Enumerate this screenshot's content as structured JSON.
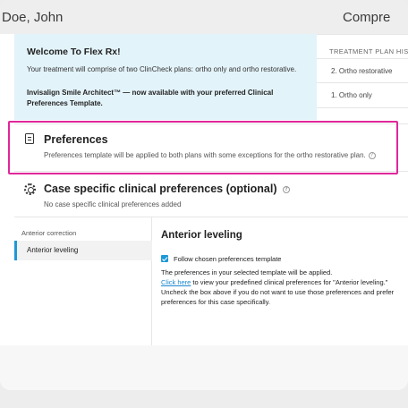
{
  "header": {
    "patient_name": "Doe, John",
    "right_title": "Compre"
  },
  "welcome": {
    "title": "Welcome To Flex Rx!",
    "text": "Your treatment will comprise of two ClinCheck plans: ortho only and ortho restorative.",
    "note": "Invisalign Smile Architect™ — now available with your preferred Clinical Preferences Template."
  },
  "history": {
    "title": "TREATMENT PLAN HISTO",
    "items": [
      "2. Ortho restorative",
      "1. Ortho only"
    ]
  },
  "preferences": {
    "title": "Preferences",
    "description": "Preferences template will be applied to both plans with some exceptions for the ortho restorative plan.",
    "help_glyph": "?"
  },
  "case_specific": {
    "title": "Case specific clinical preferences (optional)",
    "help_glyph": "?",
    "subtitle": "No case specific clinical preferences added"
  },
  "nav": {
    "heading": "Anterior correction",
    "items": [
      "Anterior leveling"
    ]
  },
  "content": {
    "title": "Anterior leveling",
    "checkbox_label": "Follow chosen preferences template",
    "checkbox_checked": true,
    "line1": "The preferences in your selected template will be applied.",
    "link_text": "Click here",
    "line2_rest": " to view your predefined clinical preferences for \"Anterior leveling.\"",
    "line3": "Uncheck the box above if you do not want to use those preferences and prefer",
    "line4": "preferences for this case specifically."
  },
  "colors": {
    "accent": "#1e98d7",
    "highlight": "#e0279a",
    "welcome_bg": "#e3f3fa",
    "link": "#1e88d0"
  },
  "icons": [
    "document-icon",
    "gear-icon",
    "help-icon",
    "checkbox-checked-icon"
  ]
}
